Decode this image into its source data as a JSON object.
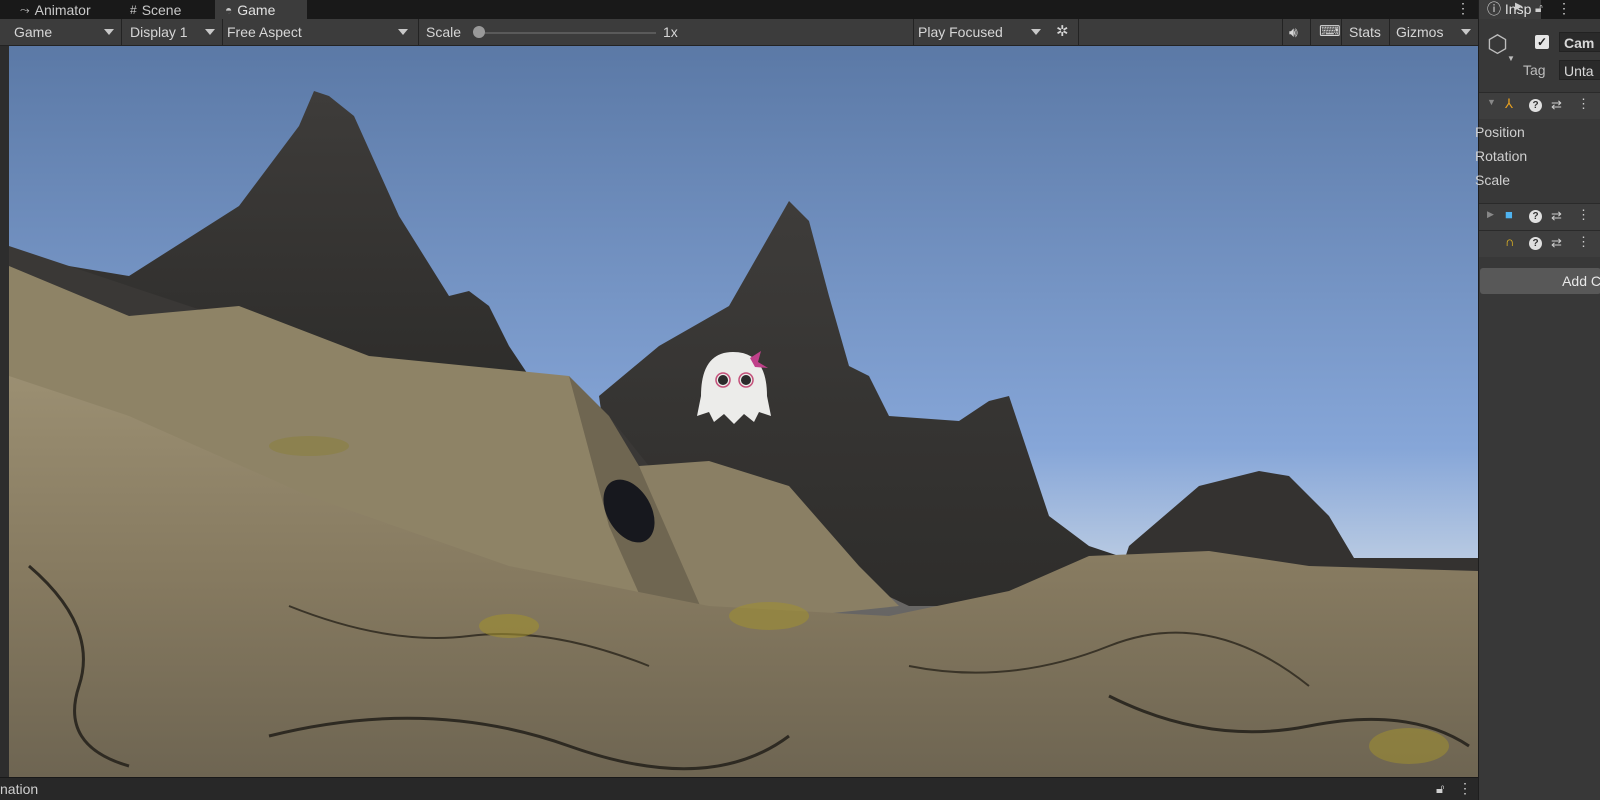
{
  "tabs": [
    {
      "label": "Animator",
      "icon": "animator-icon"
    },
    {
      "label": "Scene",
      "icon": "scene-grid-icon"
    },
    {
      "label": "Game",
      "icon": "gamepad-icon"
    }
  ],
  "toolbar": {
    "game_dropdown": "Game",
    "display_dropdown": "Display 1",
    "aspect_dropdown": "Free Aspect",
    "scale_label": "Scale",
    "scale_value": "1x",
    "scale_fraction": 0.0,
    "play_mode_dropdown": "Play Focused",
    "stats_label": "Stats",
    "gizmos_label": "Gizmos"
  },
  "bottom": {
    "panel_label": "nation"
  },
  "inspector": {
    "tab_label": "Insp",
    "object_name": "Cam",
    "tag_label": "Tag",
    "tag_value": "Unta",
    "transform_props": [
      "Position",
      "Rotation",
      "Scale"
    ],
    "add_component_label": "Add C"
  },
  "colors": {
    "sky_top": "#5b79a6",
    "sky_bottom": "#b7c9e2",
    "mountain": "#3f3d3a",
    "ground": "#8a7d64"
  }
}
